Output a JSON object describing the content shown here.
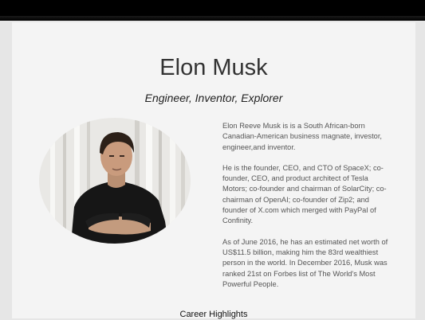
{
  "profile": {
    "name": "Elon Musk",
    "tagline": "Engineer, Inventor, Explorer",
    "photo_icon": "portrait-photo"
  },
  "bio": [
    "Elon Reeve Musk is is a South African-born Canadian-American business magnate, investor, engineer,and inventor.",
    "He is the founder, CEO, and CTO of SpaceX; co-founder, CEO, and product architect of Tesla Motors; co-founder and chairman of SolarCity; co-chairman of OpenAI; co-founder of Zip2; and founder of X.com which merged with PayPal of Confinity.",
    "As of June 2016, he has an estimated net worth of US$11.5 billion, making him the 83rd wealthiest person in the world. In December 2016, Musk was ranked 21st on Forbes list of The World's Most Powerful People."
  ],
  "sections": {
    "career_heading": "Career Highlights"
  },
  "colors": {
    "topbar": "#000000",
    "panel": "#f4f4f4",
    "page": "#e6e6e6",
    "text": "#555555"
  }
}
